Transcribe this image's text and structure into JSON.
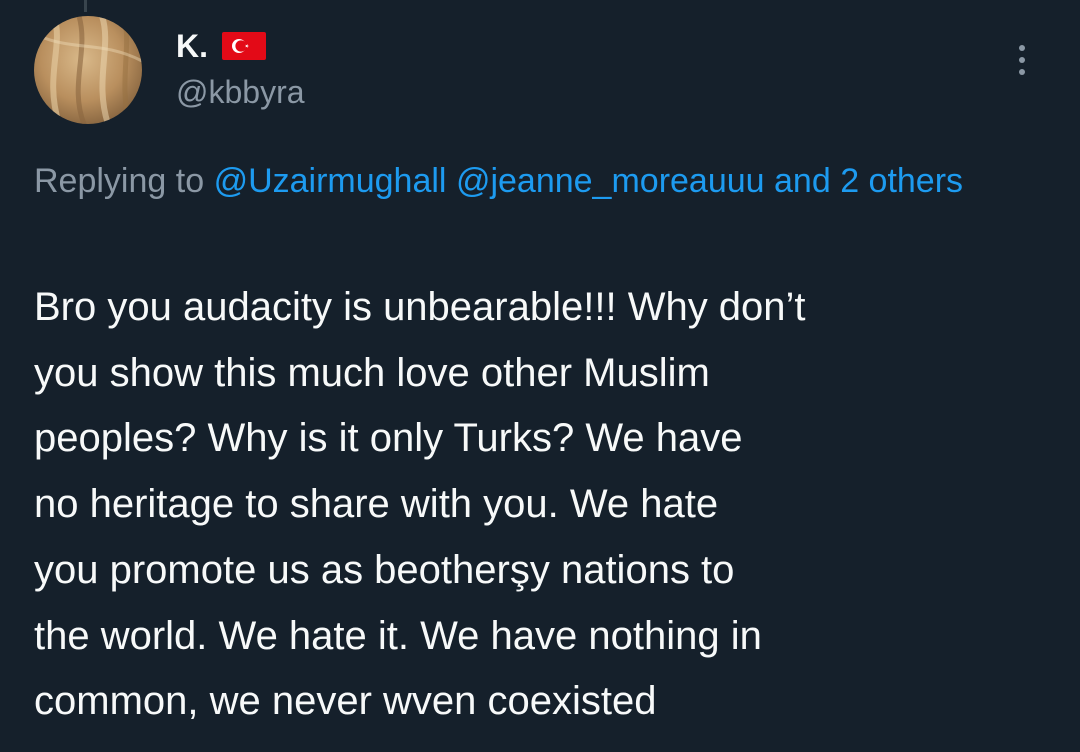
{
  "author": {
    "display_name": "K.",
    "flag": "Turkey flag",
    "handle": "@kbbyra"
  },
  "reply": {
    "prefix": "Replying to",
    "mentions": [
      "@Uzairmughall",
      "@jeanne_moreauuu"
    ],
    "others": "and 2 others"
  },
  "tweet": {
    "text": "Bro you audacity is unbearable!!! Why don’t\nyou show this much love other Muslim\npeoples? Why is it only Turks? We have\nno heritage to share with you. We hate\nyou promote us as beotherşy nations to\nthe world. We hate it. We have nothing in\ncommon, we never wven coexisted"
  },
  "icons": {
    "more": "more-options-icon"
  },
  "colors": {
    "background": "#15202b",
    "text": "#f7f9f9",
    "secondary": "#8b98a5",
    "link": "#1d9bf0",
    "flag_red": "#e30a17"
  }
}
